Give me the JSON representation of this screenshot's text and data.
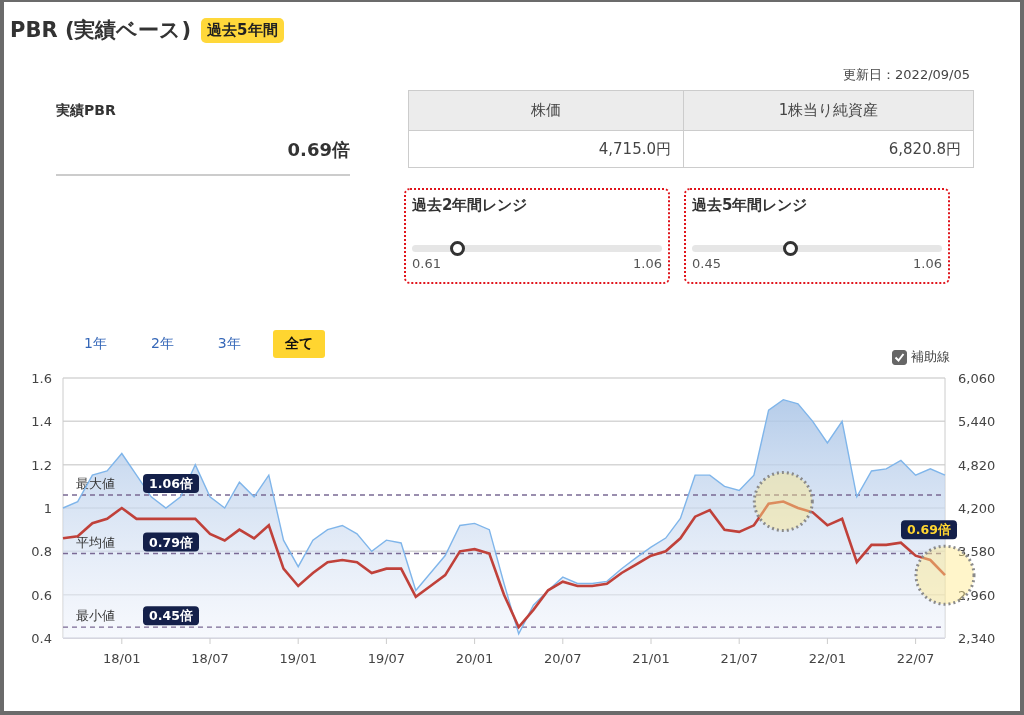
{
  "title": "PBR (実績ベース)",
  "title_badge": "過去5年間",
  "updated": "更新日：2022/09/05",
  "actual_pbr": {
    "label": "実績PBR",
    "value": "0.69倍"
  },
  "table": {
    "columns": [
      "株価",
      "1株当り純資産"
    ],
    "rows": [
      [
        "4,715.0円",
        "6,820.8円"
      ]
    ]
  },
  "ranges": [
    {
      "title": "過去2年間レンジ",
      "min": "0.61",
      "max": "1.06",
      "level": 0.18
    },
    {
      "title": "過去5年間レンジ",
      "min": "0.45",
      "max": "1.06",
      "level": 0.39
    }
  ],
  "period_tabs": [
    {
      "label": "1年",
      "selected": false
    },
    {
      "label": "2年",
      "selected": false
    },
    {
      "label": "3年",
      "selected": false
    },
    {
      "label": "全て",
      "selected": true
    }
  ],
  "guide_lines": {
    "label": "補助線",
    "checked": true
  },
  "chart_data": {
    "type": "line",
    "grid": true,
    "categories": [
      null,
      null,
      null,
      null,
      "18/01",
      null,
      null,
      null,
      null,
      null,
      "18/07",
      null,
      null,
      null,
      null,
      null,
      "19/01",
      null,
      null,
      null,
      null,
      null,
      "19/07",
      null,
      null,
      null,
      null,
      null,
      "20/01",
      null,
      null,
      null,
      null,
      null,
      "20/07",
      null,
      null,
      null,
      null,
      null,
      "21/01",
      null,
      null,
      null,
      null,
      null,
      "21/07",
      null,
      null,
      null,
      null,
      null,
      "22/01",
      null,
      null,
      null,
      null,
      null,
      "22/07",
      null,
      null
    ],
    "series": [
      {
        "color": "#7fb5ea",
        "axis": "y2",
        "type": "area",
        "values": [
          4200,
          4290,
          4670,
          4730,
          4980,
          4670,
          4360,
          4200,
          4360,
          4820,
          4360,
          4200,
          4570,
          4360,
          4670,
          3740,
          3360,
          3740,
          3890,
          3950,
          3830,
          3580,
          3740,
          3700,
          3020,
          3270,
          3520,
          3950,
          3980,
          3890,
          3120,
          2400,
          2810,
          3020,
          3210,
          3120,
          3120,
          3150,
          3330,
          3490,
          3640,
          3770,
          4050,
          4670,
          4670,
          4510,
          4450,
          4670,
          5600,
          5750,
          5690,
          5440,
          5130,
          5440,
          4360,
          4730,
          4760,
          4880,
          4670,
          4760,
          4670
        ]
      },
      {
        "color": "#c0413a",
        "values": [
          0.86,
          0.87,
          0.93,
          0.95,
          1.0,
          0.95,
          null,
          null,
          null,
          0.95,
          0.88,
          0.85,
          0.9,
          0.86,
          0.92,
          0.72,
          0.64,
          0.7,
          0.75,
          0.76,
          0.75,
          0.7,
          0.72,
          0.72,
          0.59,
          0.64,
          0.69,
          0.8,
          0.81,
          0.79,
          0.6,
          0.45,
          0.53,
          0.62,
          0.66,
          0.64,
          0.64,
          0.65,
          0.7,
          0.74,
          0.78,
          0.8,
          0.86,
          0.96,
          0.99,
          0.9,
          0.89,
          0.92,
          1.02,
          1.03,
          1.0,
          0.98,
          0.92,
          0.95,
          0.75,
          0.83,
          0.83,
          0.84,
          0.78,
          0.76,
          0.69
        ]
      }
    ],
    "ylim": [
      0.4,
      1.6
    ],
    "yticks": [
      {
        "value": 0.4,
        "label": "0.4"
      },
      {
        "value": 0.6,
        "label": "0.6"
      },
      {
        "value": 0.8,
        "label": "0.8"
      },
      {
        "value": 1.0,
        "label": "1"
      },
      {
        "value": 1.2,
        "label": "1.2"
      },
      {
        "value": 1.4,
        "label": "1.4"
      },
      {
        "value": 1.6,
        "label": "1.6"
      }
    ],
    "y2lim": [
      2340,
      6060
    ],
    "y2ticks": [
      {
        "value": 2340,
        "label": "2,340"
      },
      {
        "value": 2960,
        "label": "2,960"
      },
      {
        "value": 3580,
        "label": "3,580"
      },
      {
        "value": 4200,
        "label": "4,200"
      },
      {
        "value": 4820,
        "label": "4,820"
      },
      {
        "value": 5440,
        "label": "5,440"
      },
      {
        "value": 6060,
        "label": "6,060"
      }
    ],
    "ref_lines": [
      {
        "axis": "y",
        "value": 1.06,
        "label": "最大値"
      },
      {
        "axis": "y",
        "value": 0.79,
        "label": "平均値"
      },
      {
        "axis": "y",
        "value": 0.45,
        "label": "最小値"
      }
    ],
    "annotations": [
      "1.06倍",
      "0.79倍",
      "0.45倍",
      "0.69倍"
    ]
  }
}
